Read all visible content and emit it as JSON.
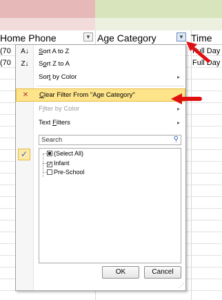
{
  "headers": {
    "home_phone": "Home Phone",
    "age_category": "Age Category",
    "time": "Time"
  },
  "rows": [
    {
      "phone": "(70",
      "time": "Full Day"
    },
    {
      "phone": "(70",
      "time": "Full Day"
    }
  ],
  "menu": {
    "sort_a_z": {
      "pre": "",
      "key": "S",
      "post": "ort A to Z"
    },
    "sort_z_a": {
      "pre": "S",
      "key": "o",
      "post": "rt Z to A"
    },
    "sort_by_color": {
      "pre": "Sor",
      "key": "t",
      "post": " by Color"
    },
    "clear_filter": {
      "pre": "",
      "key": "C",
      "post": "lear Filter From \"Age Category\""
    },
    "filter_by_color": {
      "pre": "F",
      "key": "i",
      "post": "lter by Color"
    },
    "text_filters": {
      "pre": "Text ",
      "key": "F",
      "post": "ilters"
    },
    "search_placeholder": "Search",
    "items": [
      "(Select All)",
      "Infant",
      "Pre-School"
    ],
    "ok": "OK",
    "cancel": "Cancel"
  },
  "checked": {
    "select_all": "partial",
    "infant": true,
    "pre_school": false
  },
  "colors": {
    "highlight": "#fde48a",
    "arrow": "#e01010",
    "header_pink": "#e6b8b8",
    "header_green": "#d8e4bc"
  },
  "icons": {
    "sort_asc": "sort-a-z-icon",
    "sort_desc": "sort-z-a-icon",
    "clear_filter": "clear-filter-icon",
    "search": "search-icon",
    "filter_button": "filter-funnel-icon"
  }
}
